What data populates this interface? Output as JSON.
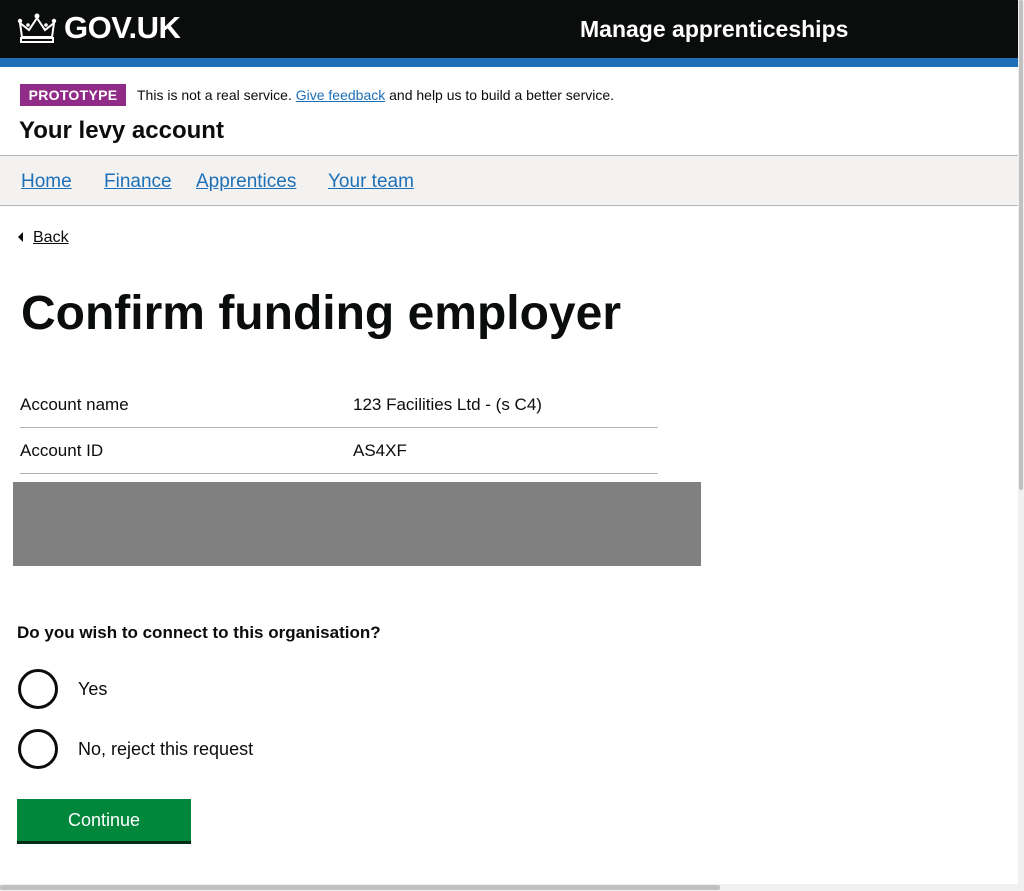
{
  "header": {
    "logo_text": "GOV.UK",
    "service_name": "Manage apprenticeships",
    "bar_color": "#0b0c0c",
    "stripe_color": "#1d70b8"
  },
  "phase_banner": {
    "tag": "PROTOTYPE",
    "text_before": "This is not a real service.",
    "feedback_link": "Give feedback",
    "text_after": "and help us to build a better service.",
    "tag_color": "#912b88"
  },
  "account_title": "Your levy account",
  "nav": {
    "items": [
      {
        "label": "Home"
      },
      {
        "label": "Finance"
      },
      {
        "label": "Apprentices"
      },
      {
        "label": "Your team"
      }
    ]
  },
  "back_link": "Back",
  "page_heading": "Confirm funding employer",
  "summary": [
    {
      "key": "Account name",
      "value": "123 Facilities Ltd - (s C4)"
    },
    {
      "key": "Account ID",
      "value": "AS4XF"
    }
  ],
  "form": {
    "question": "Do you wish to connect to this organisation?",
    "options": [
      {
        "label": "Yes",
        "selected": false
      },
      {
        "label": "No, reject this request",
        "selected": false
      }
    ],
    "submit_label": "Continue",
    "submit_color": "#00873b"
  }
}
